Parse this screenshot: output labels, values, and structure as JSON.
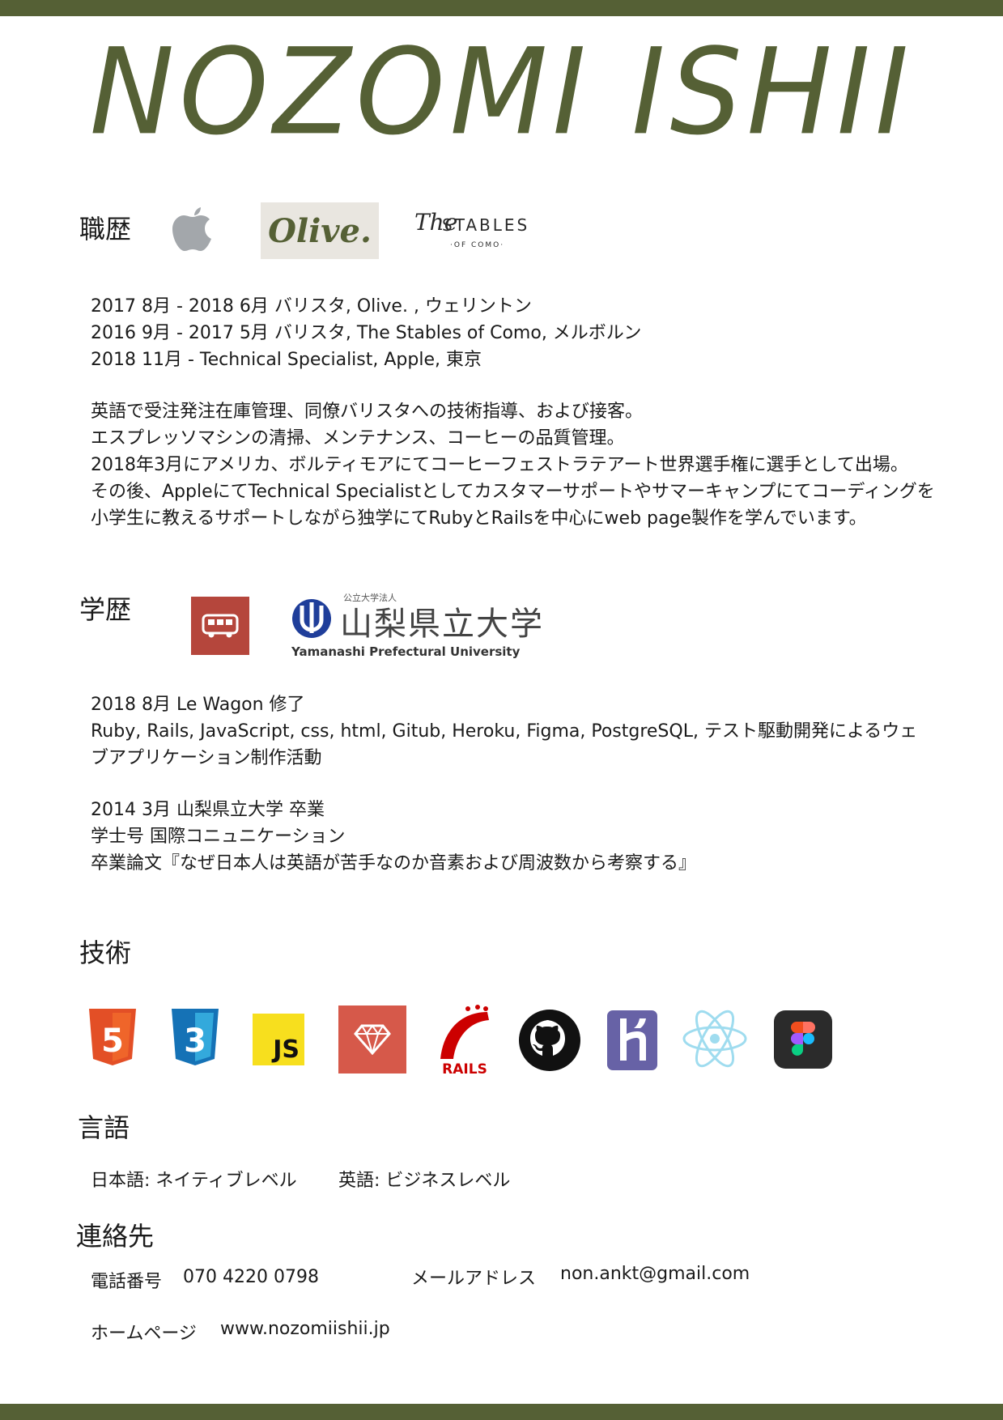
{
  "header": {
    "name": "NOZOMI ISHII"
  },
  "work": {
    "heading": "職歴",
    "logos": {
      "apple_icon": "apple-logo",
      "olive": "Olive.",
      "stables_the": "The",
      "stables_main": "STABLES",
      "stables_sub": "·OF COMO·"
    },
    "entries": [
      "2017 8月 - 2018 6月 バリスタ, Olive. , ウェリントン",
      "2016 9月 - 2017 5月 バリスタ, The Stables of Como, メルボルン",
      "2018 11月 - Technical Specialist, Apple, 東京"
    ],
    "description": [
      "英語で受注発注在庫管理、同僚バリスタへの技術指導、および接客。",
      "エスプレッソマシンの清掃、メンテナンス、コーヒーの品質管理。",
      "2018年3月にアメリカ、ボルティモアにてコーヒーフェストラテアート世界選手権に選手として出場。",
      "その後、AppleにてTechnical Specialistとしてカスタマーサポートやサマーキャンプにてコーディングを",
      "小学生に教えるサポートしながら独学にてRubyとRailsを中心にweb page製作を学んでいます。"
    ]
  },
  "education": {
    "heading": "学歴",
    "logos": {
      "bus_icon": "bus-icon",
      "univ_small": "公立大学法人",
      "univ_kanji": "山梨県立大学",
      "univ_en": "Yamanashi Prefectural University"
    },
    "block1": [
      "2018 8月  Le Wagon     修了",
      "Ruby, Rails, JavaScript, css, html, Gitub, Heroku, Figma, PostgreSQL, テスト駆動開発によるウェ",
      "ブアプリケーション制作活動"
    ],
    "block2": [
      "2014 3月  山梨県立大学    卒業",
      "学士号 国際コニュニケーション",
      "卒業論文『なぜ日本人は英語が苦手なのか音素および周波数から考察する』"
    ]
  },
  "skills": {
    "heading": "技術",
    "icons": [
      "html5-icon",
      "css3-icon",
      "javascript-icon",
      "ruby-icon",
      "rails-icon",
      "github-icon",
      "heroku-icon",
      "react-icon",
      "figma-icon"
    ],
    "js_label": "JS",
    "rails_label": "RAILS",
    "html_digit": "5",
    "css_digit": "3"
  },
  "languages": {
    "heading": "言語",
    "japanese": "日本語: ネイティブレベル",
    "english": "英語: ビジネスレベル"
  },
  "contact": {
    "heading": "連絡先",
    "phone_label": "電話番号",
    "phone": "070 4220 0798",
    "email_label": "メールアドレス",
    "email": "non.ankt@gmail.com",
    "homepage_label": "ホームページ",
    "homepage": "www.nozomiishii.jp"
  },
  "colors": {
    "accent": "#556035",
    "olive_bg": "#e9e6e0",
    "bus_red": "#b5463c"
  }
}
